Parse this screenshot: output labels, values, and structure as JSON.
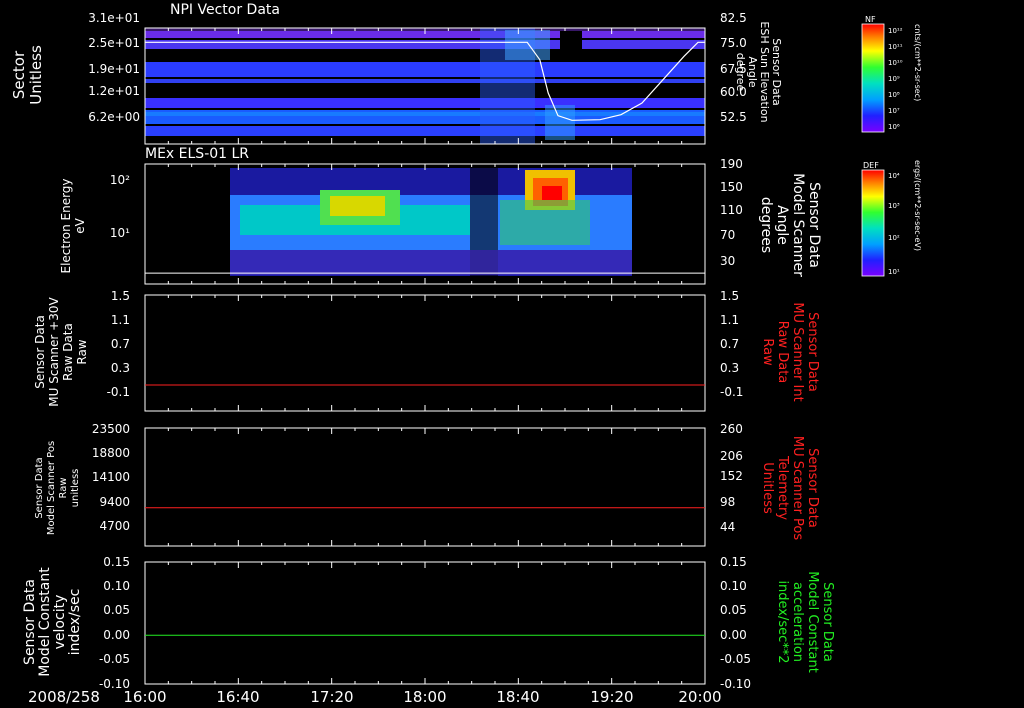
{
  "time_axis": {
    "date_label": "2008/258",
    "ticks": [
      "16:00",
      "16:40",
      "17:20",
      "18:00",
      "18:40",
      "19:20",
      "20:00"
    ]
  },
  "colors": {
    "axis": "#ffffff",
    "red_line": "#ff2020",
    "green_line": "#22ee22",
    "right_label_red": "#ff2020",
    "right_label_green": "#22ee22"
  },
  "chart_data": [
    {
      "type": "heatmap",
      "title": "NPI Vector Data",
      "ylabel_lines": [
        "Sector",
        "Unitless"
      ],
      "y_ticks": [
        "3.1e+01",
        "2.5e+01",
        "1.9e+01",
        "1.2e+01",
        "6.2e+00"
      ],
      "y2label_lines": [
        "Sensor Data",
        "ESH Sun Elevation",
        "Angle",
        "degree"
      ],
      "y2_ticks": [
        "82.5",
        "75.0",
        "67.5",
        "60.0",
        "52.5"
      ],
      "colorbar": {
        "label": "NF",
        "unit": "cnts/(cm**2-sr-sec)",
        "tick_labels": [
          "10¹²",
          "10¹¹",
          "10¹⁰",
          "10⁹",
          "10⁸",
          "10⁷",
          "10⁶"
        ]
      },
      "overlay_line": {
        "units": "degree",
        "points": [
          [
            16.0,
            75.2
          ],
          [
            18.73,
            75.2
          ],
          [
            18.82,
            70
          ],
          [
            18.88,
            60
          ],
          [
            18.95,
            53.2
          ],
          [
            19.05,
            51.8
          ],
          [
            19.25,
            52.0
          ],
          [
            19.4,
            53.5
          ],
          [
            19.55,
            57
          ],
          [
            19.7,
            64
          ],
          [
            19.85,
            71
          ],
          [
            19.95,
            75.2
          ],
          [
            20.0,
            75.2
          ]
        ]
      }
    },
    {
      "type": "heatmap",
      "title": "MEx ELS-01 LR",
      "ylabel_lines": [
        "Electron Energy",
        "eV"
      ],
      "y_ticks": [
        "10²",
        "10¹"
      ],
      "y2label_lines": [
        "Sensor Data",
        "Model Scanner",
        "Angle",
        "degrees"
      ],
      "y2_ticks": [
        "190",
        "150",
        "110",
        "70",
        "30"
      ],
      "colorbar": {
        "label": "DEF",
        "unit": "ergs/(cm**2-sr-sec-eV)",
        "tick_labels": [
          "10⁴",
          "10³",
          "10²",
          "10¹"
        ]
      },
      "overlay_line": {
        "value": 10
      }
    },
    {
      "type": "line",
      "ylabel_lines": [
        "Sensor Data",
        "MU Scanner +30V",
        "Raw Data",
        "Raw"
      ],
      "y_ticks": [
        "1.5",
        "1.1",
        "0.7",
        "0.3",
        "-0.1"
      ],
      "y2label_lines": [
        "Sensor Data",
        "MU Scanner Int",
        "Raw Data",
        "Raw"
      ],
      "y2_ticks": [
        "1.5",
        "1.1",
        "0.7",
        "0.3",
        "-0.1"
      ],
      "ylim": [
        -0.4,
        1.5
      ],
      "series": [
        {
          "value": 0.0
        }
      ]
    },
    {
      "type": "line",
      "ylabel_lines": [
        "Sensor Data",
        "Model Scanner Pos",
        "Raw",
        "unitless"
      ],
      "y_ticks": [
        "23500",
        "18800",
        "14100",
        "9400",
        "4700"
      ],
      "y2label_lines": [
        "Sensor Data",
        "MU Scanner Pos",
        "Telemetry",
        "Unitless"
      ],
      "y2_ticks": [
        "260",
        "206",
        "152",
        "98",
        "44"
      ],
      "ylim": [
        0,
        23500
      ],
      "series": [
        {
          "value": 8200
        }
      ]
    },
    {
      "type": "line",
      "ylabel_lines": [
        "Sensor Data",
        "Model Constant",
        "velocity",
        "index/sec"
      ],
      "y_ticks": [
        "0.15",
        "0.10",
        "0.05",
        "0.00",
        "-0.05",
        "-0.10"
      ],
      "y2label_lines": [
        "Sensor Data",
        "Model Constant",
        "acceleration",
        "index/sec**2"
      ],
      "y2_ticks": [
        "0.15",
        "0.10",
        "0.05",
        "0.00",
        "-0.05",
        "-0.10"
      ],
      "ylim": [
        -0.1,
        0.15
      ],
      "series": [
        {
          "value": 0.0
        }
      ]
    }
  ]
}
